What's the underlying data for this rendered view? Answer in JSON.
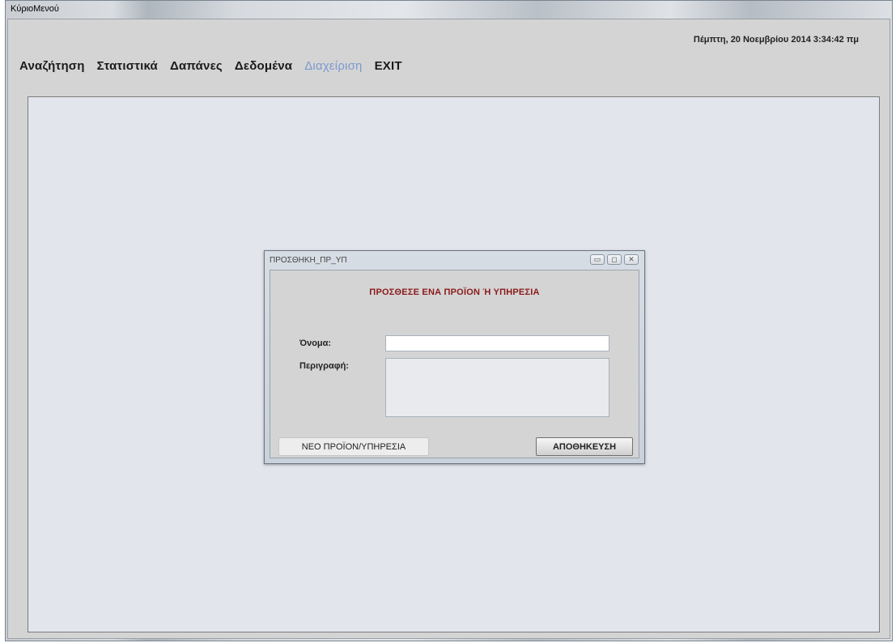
{
  "window": {
    "title": "ΚύριοΜενού"
  },
  "datetime": "Πέμπτη, 20 Νοεμβρίου 2014 3:34:42 πμ",
  "menu": [
    {
      "label": "Αναζήτηση"
    },
    {
      "label": "Στατιστικά"
    },
    {
      "label": "Δαπάνες"
    },
    {
      "label": "Δεδομένα"
    },
    {
      "label": "Διαχείριση"
    },
    {
      "label": "EXIT"
    }
  ],
  "dialog": {
    "title": "ΠΡΟΣΘΗΚΗ_ΠΡ_ΥΠ",
    "heading": "ΠΡΟΣΘΕΣΕ ΕΝΑ ΠΡΟΪΟΝ Ή ΥΠΗΡΕΣΙΑ",
    "name_label": "Όνομα:",
    "name_value": "",
    "description_label": "Περιγραφή:",
    "description_value": "",
    "new_button": "ΝΕΟ  ΠΡΟΪΟΝ/ΥΠΗΡΕΣΙΑ",
    "save_button": "ΑΠΟΘΗΚΕΥΣΗ"
  },
  "icons": [
    "minimize-icon",
    "maximize-icon",
    "close-icon"
  ]
}
